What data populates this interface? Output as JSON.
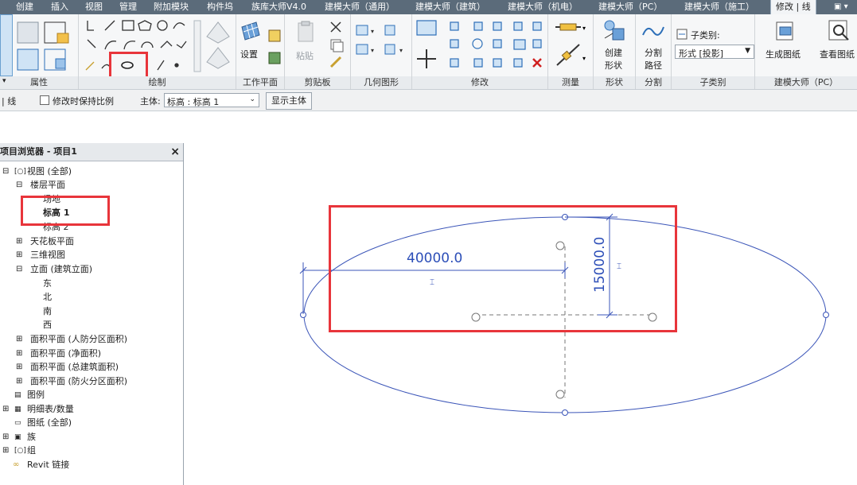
{
  "tabs": [
    "创建",
    "插入",
    "视图",
    "管理",
    "附加模块",
    "构件坞",
    "族库大师V4.0",
    "建模大师（通用）",
    "建模大师（建筑）",
    "建模大师（机电）",
    "建模大师（PC）",
    "建模大师（施工）",
    "修改 | 线"
  ],
  "ribbon": {
    "panels": {
      "properties": "属性",
      "draw": "绘制",
      "workplane": "工作平面",
      "clipboard": "剪贴板",
      "geometry": "几何图形",
      "modify": "修改",
      "measure": "测量",
      "form": "形状",
      "divide": "分割",
      "subcategory": "子类别",
      "jianmo_pc": "建模大师（PC）"
    },
    "workplane_set": "设置",
    "paste": "粘贴",
    "create_form": [
      "创建",
      "形状"
    ],
    "divide_path": [
      "分割",
      "路径"
    ],
    "subcategory_label": "子类别:",
    "subcategory_value": "形式 [投影]",
    "generate_drawing": "生成图纸",
    "view_drawing": "查看图纸"
  },
  "options_bar": {
    "mode": "| 线",
    "keep_ratio": "修改时保持比例",
    "host_label": "主体:",
    "host_value": "标高 : 标高 1",
    "show_host": "显示主体"
  },
  "browser": {
    "title": "项目浏览器 - 项目1",
    "close": "×",
    "items": [
      {
        "label": "视图 (全部)",
        "level": 0,
        "expander": "⊟"
      },
      {
        "label": "楼层平面",
        "level": 1,
        "expander": "⊟"
      },
      {
        "label": "场地",
        "level": 2,
        "expander": ""
      },
      {
        "label": "标高 1",
        "level": 2,
        "expander": "",
        "bold": true
      },
      {
        "label": "标高 2",
        "level": 2,
        "expander": ""
      },
      {
        "label": "天花板平面",
        "level": 1,
        "expander": "⊞"
      },
      {
        "label": "三维视图",
        "level": 1,
        "expander": "⊞"
      },
      {
        "label": "立面 (建筑立面)",
        "level": 1,
        "expander": "⊟"
      },
      {
        "label": "东",
        "level": 2,
        "expander": ""
      },
      {
        "label": "北",
        "level": 2,
        "expander": ""
      },
      {
        "label": "南",
        "level": 2,
        "expander": ""
      },
      {
        "label": "西",
        "level": 2,
        "expander": ""
      },
      {
        "label": "面积平面 (人防分区面积)",
        "level": 1,
        "expander": "⊞"
      },
      {
        "label": "面积平面 (净面积)",
        "level": 1,
        "expander": "⊞"
      },
      {
        "label": "面积平面 (总建筑面积)",
        "level": 1,
        "expander": "⊞"
      },
      {
        "label": "面积平面 (防火分区面积)",
        "level": 1,
        "expander": "⊞"
      },
      {
        "label": "图例",
        "level": 0,
        "expander": ""
      },
      {
        "label": "明细表/数量",
        "level": 0,
        "expander": "⊞"
      },
      {
        "label": "图纸 (全部)",
        "level": 0,
        "expander": ""
      },
      {
        "label": "族",
        "level": 0,
        "expander": "⊞"
      },
      {
        "label": "组",
        "level": 0,
        "expander": "⊞"
      },
      {
        "label": "Revit 链接",
        "level": 0,
        "expander": ""
      }
    ]
  },
  "canvas": {
    "dim_horizontal": "40000.0",
    "dim_vertical": "15000.0"
  },
  "colors": {
    "highlight": "#e8353b",
    "sketch": "#2d4fb8"
  }
}
